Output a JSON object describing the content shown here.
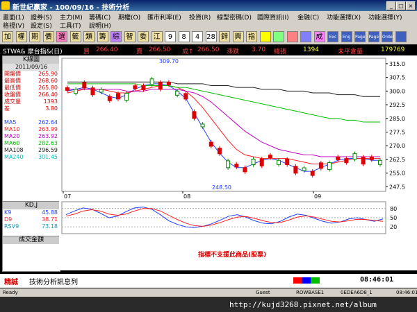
{
  "window": {
    "title": "新世紀贏家 - 100/09/16 - 技術分析"
  },
  "menu": {
    "row1": [
      "畫面(1)",
      "證券(S)",
      "主力(M)",
      "籌碼(C)",
      "期權(O)",
      "匯市利率(E)",
      "投資(R)",
      "線型密碼(D)",
      "國際資訊(I)",
      "金融(C)",
      "功能選擇(X)",
      "功能選擇(Y)"
    ],
    "row2": [
      "格視(V)",
      "設定(S)",
      "工具(T)",
      "說明(H)"
    ]
  },
  "toolbar": {
    "buttons": [
      "加",
      "權",
      "期",
      "價",
      "選",
      "籤",
      "類",
      "籌",
      "綜",
      "智",
      "委",
      "江",
      "9",
      "8",
      "4",
      "28",
      "鋅",
      "興",
      "指",
      "",
      "",
      "",
      "",
      "成",
      "Exc",
      "Eng",
      "Page",
      "Page",
      "Order",
      ""
    ]
  },
  "quote": {
    "symbol": "STWA& 摩台指&(日)",
    "buy_label": "買",
    "buy": "266.40",
    "sell_label": "賣",
    "sell": "266.50",
    "deal_label": "成↑",
    "deal": "266.50",
    "change_label": "漲跌",
    "change": "3.70",
    "volume_label": "總張",
    "volume": "1394",
    "oi_label": "未平倉量",
    "oi": "179769"
  },
  "kpanel": {
    "title": "K線圖",
    "date": "2011/09/16",
    "rows": [
      {
        "label": "開盤價",
        "value": "265.90",
        "color": "#d00000"
      },
      {
        "label": "最高價",
        "value": "268.60",
        "color": "#d00000"
      },
      {
        "label": "最低價",
        "value": "265.80",
        "color": "#d00000"
      },
      {
        "label": "收盤價",
        "value": "266.40",
        "color": "#d00000"
      },
      {
        "label": "成交量",
        "value": "1393",
        "color": "#d00000"
      },
      {
        "label": "差",
        "value": "3.80",
        "color": "#d00000"
      },
      {
        "label": "",
        "value": "",
        "color": "#000"
      },
      {
        "label": "MA5",
        "value": "262.64",
        "color": "#2040ff"
      },
      {
        "label": "MA10",
        "value": "263.99",
        "color": "#ff2020"
      },
      {
        "label": "MA20",
        "value": "263.92",
        "color": "#c000c0"
      },
      {
        "label": "MA60",
        "value": "282.63",
        "color": "#00c000"
      },
      {
        "label": "MA108",
        "value": "296.59",
        "color": "#202020"
      },
      {
        "label": "MA240",
        "value": "301.45",
        "color": "#00c0c0"
      }
    ]
  },
  "chart": {
    "ticks_y": [
      "315.0",
      "307.5",
      "300.0",
      "292.5",
      "285.0",
      "277.5",
      "270.0",
      "262.5",
      "255.0",
      "247.5"
    ],
    "ticks_x": [
      "07",
      "08",
      "09"
    ],
    "high_label": "309.70",
    "low_label": "248.50"
  },
  "kd": {
    "title": "KD,J",
    "rows": [
      {
        "label": "K9",
        "value": "45.88",
        "color": "#2040ff"
      },
      {
        "label": "D9",
        "value": "38.71",
        "color": "#ff2020"
      },
      {
        "label": "RSV9",
        "value": "73.18",
        "color": "#00a0c0"
      }
    ],
    "ticks": [
      "80",
      "50",
      "20"
    ]
  },
  "vol": {
    "title": "成交金額",
    "message": "指標不支援此商品(股票)"
  },
  "msg": {
    "left": "精誠",
    "text": "技術分析訊息列",
    "time": "08:46:01"
  },
  "status": {
    "ready": "Ready",
    "guest": "Guest",
    "row": "ROWBASE1",
    "code": "0EDEA6D8_1",
    "time": "08:46:01"
  },
  "taskbar": {
    "url": "http://kujd3268.pixnet.net/album"
  },
  "chart_data": {
    "type": "line",
    "title": "",
    "ylim": [
      245,
      318
    ],
    "x_ticks": [
      "07",
      "08",
      "09"
    ],
    "series": [
      {
        "name": "MA5",
        "color": "#2040ff",
        "values": [
          300,
          301,
          302,
          301,
          299,
          297,
          296,
          298,
          301,
          303,
          304,
          304,
          303,
          300,
          296,
          288,
          280,
          272,
          266,
          261,
          258,
          258,
          260,
          262,
          263,
          262,
          260,
          258,
          256,
          256,
          258,
          260,
          262,
          263,
          263,
          263,
          262,
          262
        ]
      },
      {
        "name": "MA10",
        "color": "#ff2020",
        "values": [
          299,
          300,
          301,
          301,
          301,
          300,
          299,
          299,
          300,
          301,
          302,
          303,
          303,
          302,
          300,
          296,
          291,
          285,
          279,
          273,
          268,
          265,
          264,
          263,
          263,
          263,
          263,
          262,
          261,
          260,
          260,
          260,
          261,
          262,
          263,
          263,
          263,
          263
        ]
      },
      {
        "name": "MA20",
        "color": "#c000c0",
        "values": [
          301,
          301,
          301,
          301,
          301,
          301,
          301,
          300,
          300,
          300,
          301,
          301,
          301,
          301,
          300,
          299,
          297,
          294,
          290,
          286,
          282,
          278,
          275,
          272,
          270,
          268,
          267,
          266,
          265,
          265,
          264,
          264,
          264,
          264,
          264,
          264,
          264,
          264
        ]
      },
      {
        "name": "MA60",
        "color": "#00c000",
        "values": [
          304,
          304,
          304,
          304,
          304,
          304,
          304,
          304,
          304,
          303,
          303,
          303,
          303,
          302,
          302,
          301,
          300,
          299,
          298,
          297,
          296,
          295,
          294,
          293,
          292,
          291,
          290,
          289,
          288,
          287,
          286,
          285,
          285,
          284,
          284,
          283,
          283,
          283
        ]
      },
      {
        "name": "MA108",
        "color": "#202020",
        "values": [
          305,
          305,
          305,
          305,
          305,
          305,
          305,
          305,
          305,
          305,
          305,
          305,
          305,
          304,
          304,
          304,
          304,
          303,
          303,
          303,
          302,
          302,
          302,
          301,
          301,
          301,
          300,
          300,
          300,
          299,
          299,
          299,
          298,
          298,
          298,
          297,
          297,
          297
        ]
      }
    ]
  }
}
